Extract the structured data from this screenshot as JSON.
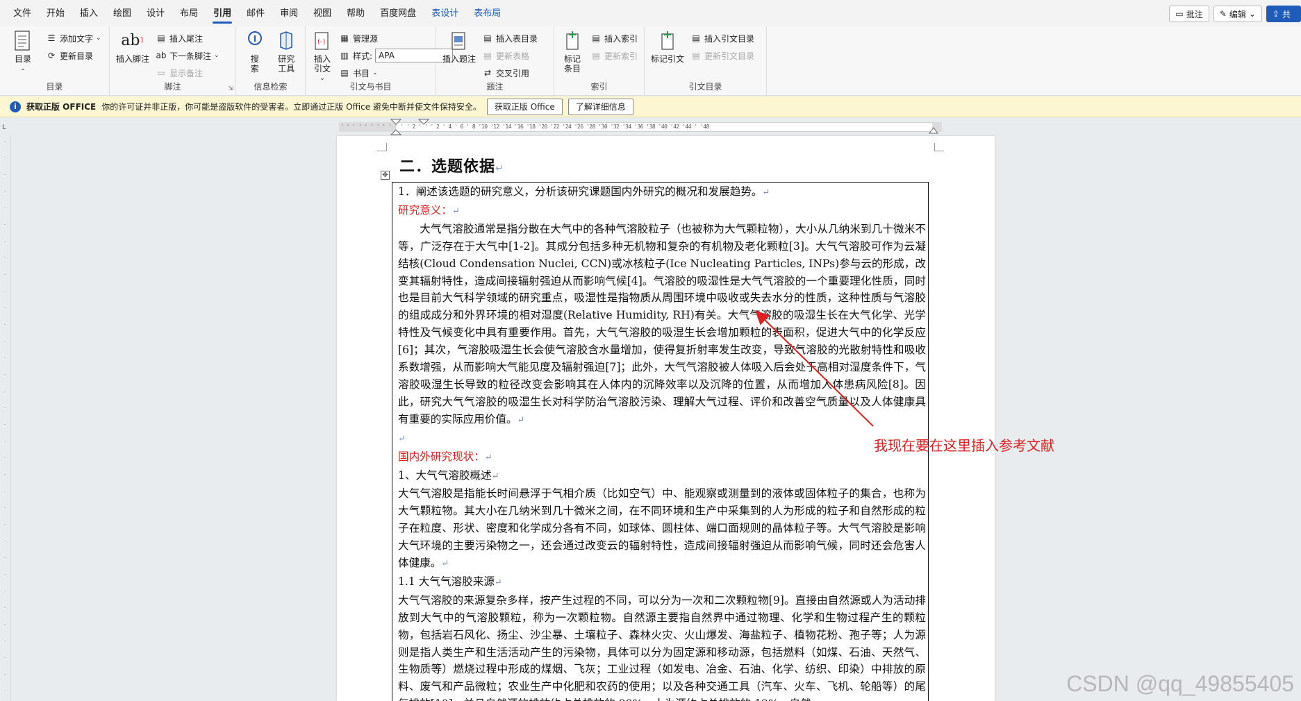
{
  "menu": {
    "tabs": [
      "文件",
      "开始",
      "插入",
      "绘图",
      "设计",
      "布局",
      "引用",
      "邮件",
      "审阅",
      "视图",
      "帮助",
      "百度网盘"
    ],
    "active_tab": "引用",
    "context_tabs": [
      "表设计",
      "表布局"
    ],
    "right": {
      "comment": "批注",
      "edit": "编辑",
      "share": "共"
    }
  },
  "ribbon": {
    "toc": {
      "label": "目录",
      "big": "目录",
      "add_text": "添加文字",
      "update": "更新目录"
    },
    "footnote": {
      "label": "脚注",
      "insert_footnote": "插入脚注",
      "insert_endnote": "插入尾注",
      "next_footnote": "下一条脚注",
      "show_notes": "显示备注"
    },
    "research": {
      "label": "信息检索",
      "search": "搜索",
      "researcher": "研究工具"
    },
    "citation": {
      "label": "引文与书目",
      "insert_citation": "插入引文",
      "manage_sources": "管理源",
      "style_label": "样式:",
      "style_value": "APA",
      "bibliography": "书目"
    },
    "captions": {
      "label": "题注",
      "insert_caption": "插入题注",
      "insert_table_of_figures": "插入表目录",
      "update_table": "更新表格",
      "cross_reference": "交叉引用"
    },
    "index": {
      "label": "索引",
      "mark_entry": "标记条目",
      "insert_index": "插入索引",
      "update_index": "更新索引"
    },
    "toa": {
      "label": "引文目录",
      "mark_citation": "标记引文",
      "insert_toa": "插入引文目录",
      "update_toa": "更新引文目录"
    }
  },
  "infobar": {
    "title": "获取正版 OFFICE",
    "message": "你的许可证并非正版，你可能是盗版软件的受害者。立即通过正版 Office 避免中断并使文件保持安全。",
    "btn_get": "获取正版 Office",
    "btn_learn": "了解详细信息"
  },
  "ruler": {
    "ticks": "  ' ' ' ' ' ' ' ' ' ' ' ' 2 ' ' ' 2 ' 4 ' 6 ' 8 '10 '12 '14 '16 '18 '20 '22 '24 '26 '28 '30 '32 '34 '36 '38 '40 '42 '44 ' '48"
  },
  "document": {
    "heading": "二．选题依据",
    "item1": "1．阐述该选题的研究意义，分析该研究课题国内外研究的概况和发展趋势。",
    "sig_title": "研究意义：",
    "sig_para": "大气气溶胶通常是指分散在大气中的各种气溶胶粒子（也被称为大气颗粒物），大小从几纳米到几十微米不等，广泛存在于大气中[1-2]。其成分包括多种无机物和复杂的有机物及老化颗粒[3]。大气气溶胶可作为云凝结核(Cloud Condensation Nuclei, CCN)或冰核粒子(Ice Nucleating Particles, INPs)参与云的形成，改变其辐射特性，造成间接辐射强迫从而影响气候[4]。气溶胶的吸湿性是大气气溶胶的一个重要理化性质，同时也是目前大气科学领域的研究重点，吸湿性是指物质从周围环境中吸收或失去水分的性质，这种性质与气溶胶的组成成分和外界环境的相对湿度(Relative Humidity, RH)有关。大气气溶胶的吸湿生长在大气化学、光学特性及气候变化中具有重要作用。首先，大气气溶胶的吸湿生长会增加颗粒的表面积，促进大气中的化学反应[6]；其次，气溶胶吸湿生长会使气溶胶含水量增加，使得复折射率发生改变，导致气溶胶的光散射特性和吸收系数增强，从而影响大气能见度及辐射强迫[7]；此外，大气气溶胶被人体吸入后会处于高相对湿度条件下，气溶胶吸湿生长导致的粒径改变会影响其在人体内的沉降效率以及沉降的位置，从而增加人体患病风险[8]。因此，研究大气气溶胶的吸湿生长对科学防治气溶胶污染、理解大气过程、评价和改善空气质量以及人体健康具有重要的实际应用价值。",
    "status_title": "国内外研究现状：",
    "s1_title": "1、大气气溶胶概述",
    "s1_para": "大气气溶胶是指能长时间悬浮于气相介质（比如空气）中、能观察或测量到的液体或固体粒子的集合，也称为大气颗粒物。其大小在几纳米到几十微米之间，在不同环境和生产中采集到的人为形成的粒子和自然形成的粒子在粒度、形状、密度和化学成分各有不同，如球体、圆柱体、端口面规则的晶体粒子等。大气气溶胶是影响大气环境的主要污染物之一，还会通过改变云的辐射特性，造成间接辐射强迫从而影响气候，同时还会危害人体健康。",
    "s11_title": "1.1 大气气溶胶来源",
    "s11_para": "大气气溶胶的来源复杂多样，按产生过程的不同，可以分为一次和二次颗粒物[9]。直接由自然源或人为活动排放到大气中的气溶胶颗粒，称为一次颗粒物。自然源主要指自然界中通过物理、化学和生物过程产生的颗粒物，包括岩石风化、扬尘、沙尘暴、土壤粒子、森林火灾、火山爆发、海盐粒子、植物花粉、孢子等；人为源则是指人类生产和生活活动产生的污染物，具体可以分为固定源和移动源，包括燃料（如煤、石油、天然气、生物质等）燃烧过程中形成的煤烟、飞灰；工业过程（如发电、冶金、石油、化学、纺织、印染）中排放的原料、废气和产品微粒；农业生产中化肥和农药的使用；以及各种交通工具（汽车、火车、飞机、轮船等）的尾气排放[10]。并且自然源的排放约占总排放的 88%，人为源约占总排放的 12%，自然"
  },
  "annotation": "我现在要在这里插入参考文献",
  "watermark": "CSDN @qq_49855405",
  "colors": {
    "accent": "#1f5bb8",
    "annotation": "#e02020",
    "infobar": "#fdf6d3"
  }
}
